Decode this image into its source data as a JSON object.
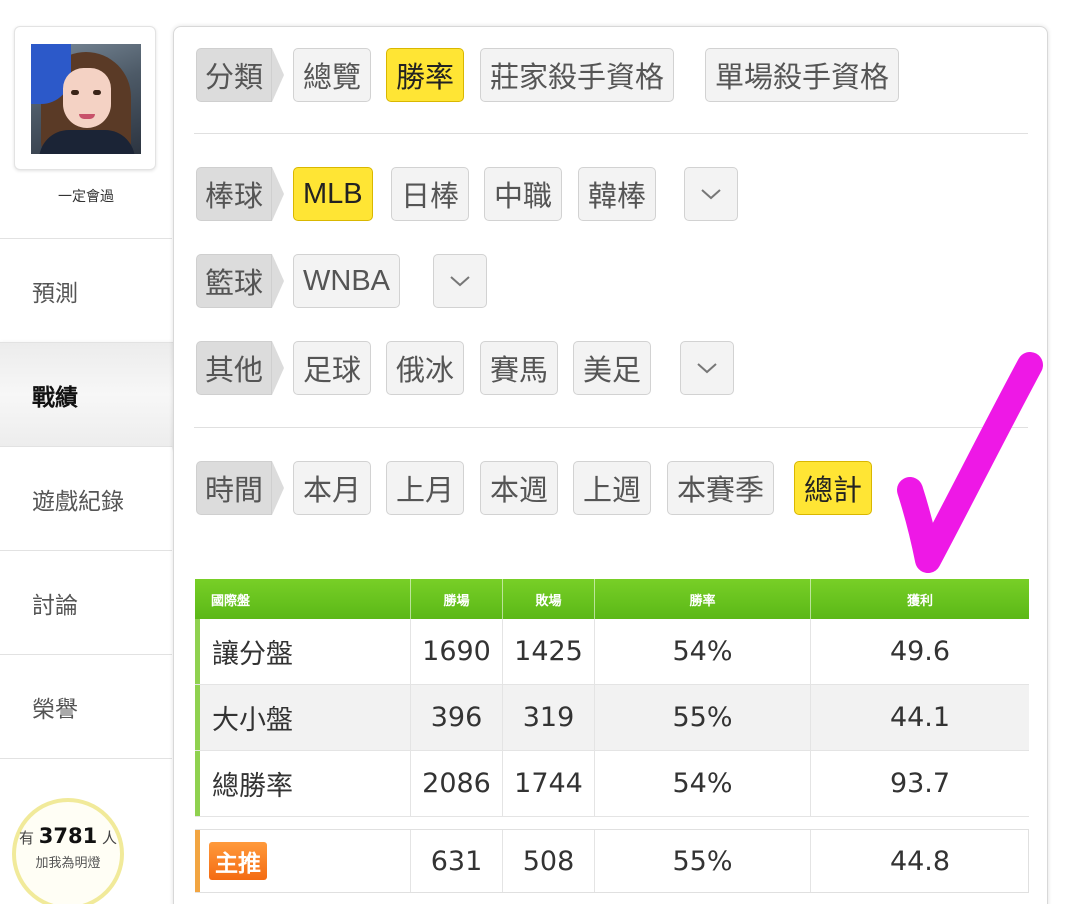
{
  "sidebar": {
    "username": "一定會過",
    "items": [
      {
        "label": "預測",
        "active": false
      },
      {
        "label": "戰績",
        "active": true
      },
      {
        "label": "遊戲紀錄",
        "active": false
      },
      {
        "label": "討論",
        "active": false
      },
      {
        "label": "榮譽",
        "active": false
      }
    ],
    "fans": {
      "prefix": "有",
      "count": "3781",
      "suffix": "人",
      "caption": "加我為明燈"
    }
  },
  "filters": {
    "category": {
      "label": "分類",
      "options": [
        "總覽",
        "勝率",
        "莊家殺手資格",
        "單場殺手資格"
      ],
      "selected": "勝率"
    },
    "baseball": {
      "label": "棒球",
      "options": [
        "MLB",
        "日棒",
        "中職",
        "韓棒"
      ],
      "selected": "MLB"
    },
    "basketball": {
      "label": "籃球",
      "options": [
        "WNBA"
      ],
      "selected": ""
    },
    "other": {
      "label": "其他",
      "options": [
        "足球",
        "俄冰",
        "賽馬",
        "美足"
      ],
      "selected": ""
    },
    "time": {
      "label": "時間",
      "options": [
        "本月",
        "上月",
        "本週",
        "上週",
        "本賽季",
        "總計"
      ],
      "selected": "總計"
    }
  },
  "table": {
    "headers": [
      "國際盤",
      "勝場",
      "敗場",
      "勝率",
      "獲利"
    ],
    "rows": [
      [
        "讓分盤",
        "1690",
        "1425",
        "54%",
        "49.6"
      ],
      [
        "大小盤",
        "396",
        "319",
        "55%",
        "44.1"
      ],
      [
        "總勝率",
        "2086",
        "1744",
        "54%",
        "93.7"
      ]
    ],
    "featured": {
      "badge": "主推",
      "cells": [
        "631",
        "508",
        "55%",
        "44.8"
      ]
    }
  },
  "colors": {
    "selected_chip": "#ffe534",
    "table_header": "#6cc322",
    "row_accent": "#8fd14f",
    "featured_accent": "#f2a541",
    "check_mark": "#ee18e6"
  }
}
